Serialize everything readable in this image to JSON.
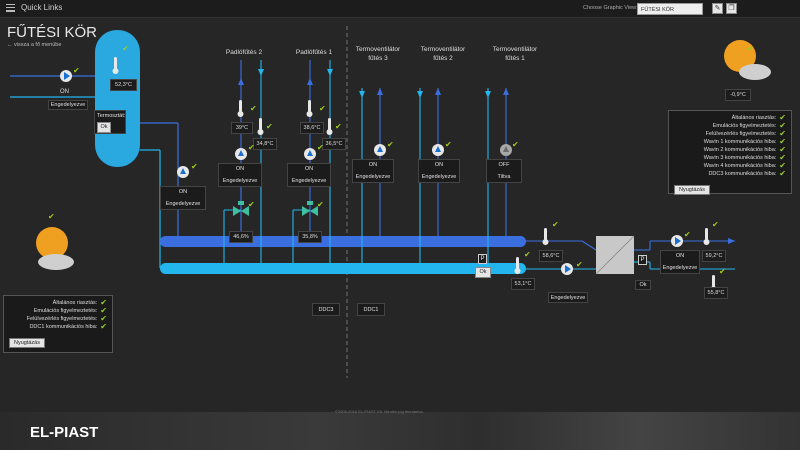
{
  "topbar": {
    "quick_links": "Quick Links",
    "choose_view_label": "Choose Graphic View:",
    "choose_view_value": "FŰTÉSI KÖR"
  },
  "page": {
    "title": "FŰTÉSI KÖR",
    "back_link": "← vissza a fő menübe"
  },
  "tank": {
    "temp": "52,3°C",
    "pump_state": "ON",
    "pump_status": "Engedelyezve",
    "thermostat_label": "Termosztát:",
    "thermostat_value": "Ok"
  },
  "main_pump": {
    "state": "ON",
    "status": "Engedelyezve"
  },
  "circuits": [
    {
      "name": "Padlófűtés 2",
      "temp_supply": "39°C",
      "temp_return": "34,8°C",
      "pump_state": "ON",
      "pump_status": "Engedelyezve",
      "valve": "46,6%"
    },
    {
      "name": "Padlófűtés 1",
      "temp_supply": "38,6°C",
      "temp_return": "36,5°C",
      "pump_state": "ON",
      "pump_status": "Engedelyezve",
      "valve": "35,8%"
    },
    {
      "name": "Termoventilátor fűtés 3",
      "pump_state": "ON",
      "pump_status": "Engedelyezve"
    },
    {
      "name": "Termoventilátor fűtés 2",
      "pump_state": "ON",
      "pump_status": "Engedelyezve"
    },
    {
      "name": "Termoventilátor fűtés 1",
      "pump_state": "OFF",
      "pump_status": "Tiltva"
    }
  ],
  "right_side": {
    "supply_temp": "58,6°C",
    "return_temp": "53,1°C",
    "p1_label": "P",
    "p1_status": "Ok",
    "pump2_status": "Engedelyezve",
    "p2_label": "P",
    "p2_status": "Ok",
    "pump3_state": "ON",
    "pump3_status": "Engedelyezve",
    "temp3": "59,2°C",
    "temp4": "55,8°C"
  },
  "ddc": {
    "ddc3": "DDC3",
    "ddc1": "DDC1"
  },
  "weather": {
    "outside_temp": "-0,9°C"
  },
  "status_right": {
    "rows": [
      "Általános riasztás:",
      "Emulációs figyelmeztetés:",
      "Felülvezérlés figyelmeztetés:",
      "Wavin 1 kommunikációs hiba:",
      "Wavin 2 kommunikációs hiba:",
      "Wavin 3 kommunikációs hiba:",
      "Wavin 4 kommunikációs hiba:",
      "DDC3 kommunikációs hiba:"
    ],
    "reset": "Nyugtázás"
  },
  "status_left": {
    "rows": [
      "Általános riasztás:",
      "Emulációs figyelmeztetés:",
      "Felülvezérlés figyelmeztetés:",
      "DDC1 kommunikációs hiba:"
    ],
    "reset": "Nyugtázás"
  },
  "footer": {
    "logo": "EL-PIAST",
    "copyright": "©2006-2016 EL-PIAST Kft. Minden jog fenntartva."
  },
  "colors": {
    "supply_pipe": "#3b6fe0",
    "return_pipe": "#22b5ee",
    "accent_check": "#9ccc1a",
    "tank": "#2aa8e0"
  }
}
